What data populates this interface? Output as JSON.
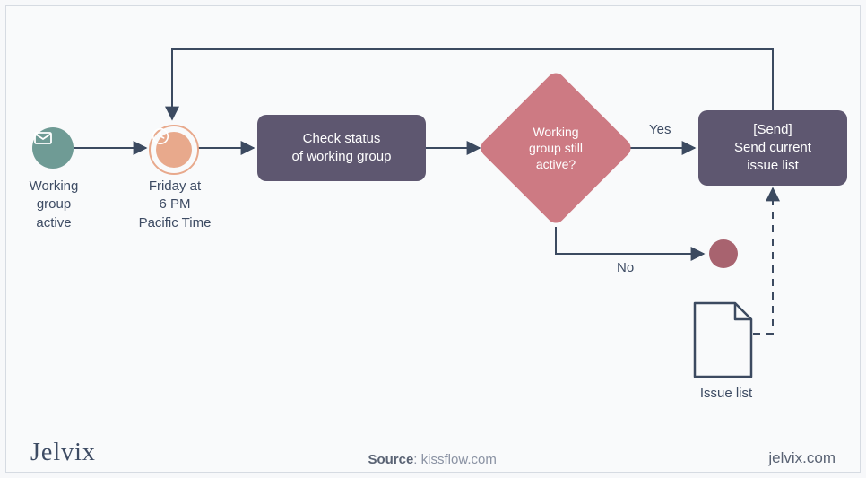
{
  "nodes": {
    "start": {
      "label": "Working\ngroup\nactive",
      "icon": "mail-icon"
    },
    "timer": {
      "label": "Friday at\n6 PM\nPacific Time",
      "icon": "clock-icon"
    },
    "check": {
      "label": "Check status\nof working group"
    },
    "decision": {
      "label": "Working\ngroup still\nactive?"
    },
    "send": {
      "label": "[Send]\nSend current\nissue list"
    },
    "end": {
      "label": ""
    },
    "doc": {
      "label": "Issue list",
      "icon": "document-icon"
    }
  },
  "edges": {
    "yes": "Yes",
    "no": "No"
  },
  "footer": {
    "brand": "Jelvix",
    "source_prefix": "Source",
    "source_value": "kissflow.com",
    "site": "jelvix.com"
  },
  "colors": {
    "line": "#3c4a60",
    "process_bg": "#5e5770",
    "decision_bg": "#cd7a83",
    "start_bg": "#6f9b95",
    "timer_bg": "#e8a98c",
    "end_bg": "#a8636f"
  }
}
